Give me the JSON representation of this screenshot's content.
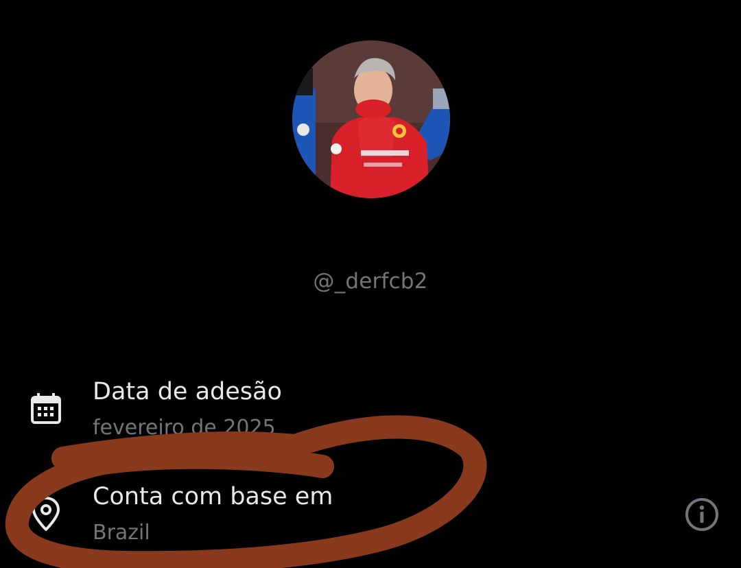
{
  "profile": {
    "username": "@_derfcb2",
    "avatar_alt": "profile-photo"
  },
  "about": {
    "joined": {
      "title": "Data de adesão",
      "value": "fevereiro de 2025",
      "icon": "calendar-icon"
    },
    "location": {
      "title": "Conta com base em",
      "value": "Brazil",
      "icon": "location-pin-icon",
      "info_icon": "info-icon"
    }
  },
  "colors": {
    "background": "#000000",
    "primary_text": "#e7e9ea",
    "secondary_text": "#71767b",
    "annotation_stroke": "#8a3a1c",
    "jersey_red": "#d8202a"
  }
}
